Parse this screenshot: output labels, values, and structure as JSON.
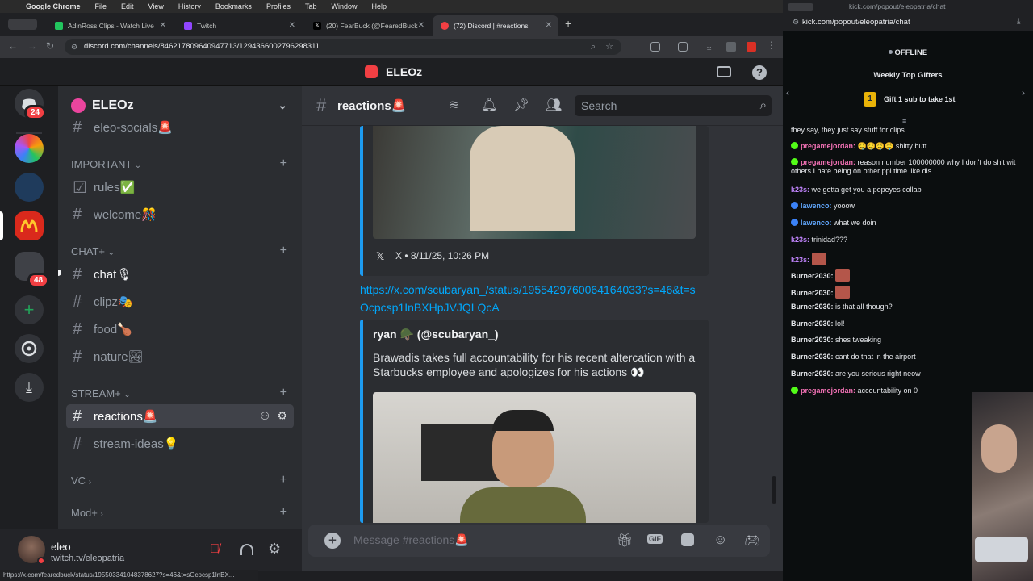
{
  "menubar": {
    "items": [
      "Google Chrome",
      "File",
      "Edit",
      "View",
      "History",
      "Bookmarks",
      "Profiles",
      "Tab",
      "Window",
      "Help"
    ]
  },
  "browser": {
    "tabs": [
      {
        "label": "AdinRoss Clips - Watch Live",
        "active": false
      },
      {
        "label": "Twitch",
        "active": false
      },
      {
        "label": "(20) FearBuck (@FearedBuck",
        "active": false
      },
      {
        "label": "(72) Discord | #reactions",
        "active": true
      }
    ],
    "url": "discord.com/channels/846217809640947713/1294366002796298311",
    "status_url": "https://x.com/fearedbuck/status/195503341048378627?s=46&t=sOcpcsp1lnBX..."
  },
  "discord": {
    "app_title": "ELEOz",
    "rail": {
      "dm_badge": "24",
      "folder_badge": "48"
    },
    "server_name": "ELEOz",
    "categories": {
      "important": "IMPORTANT",
      "chat": "CHAT+",
      "stream": "STREAM+",
      "vc": "VC",
      "mod": "Mod+"
    },
    "channels": {
      "partial": "eleo-socials🚨",
      "rules": "rules✅",
      "welcome": "welcome🎊",
      "chat": "chat🎙",
      "clipz": "clipz🎭",
      "food": "food🍗",
      "nature": "nature🏞",
      "reactions": "reactions🚨",
      "stream_ideas": "stream-ideas💡"
    },
    "channel_title": "reactions🚨",
    "search_placeholder": "Search",
    "messages": {
      "embed1_footer_source": "X",
      "embed1_footer_time": "• 8/11/25, 10:26 PM",
      "link": "https://x.com/scubaryan_/status/1955429760064164033?s=46&t=sOcpcsp1InBXHpJVJQLQcA",
      "embed2_author": "ryan 🪖 (@scubaryan_)",
      "embed2_text": "Brawadis takes full accountability for his recent altercation with a Starbucks employee and apologizes for his actions 👀"
    },
    "composer_placeholder": "Message #reactions🚨",
    "user": {
      "name": "eleo",
      "status": "twitch.tv/eleopatria"
    }
  },
  "kick": {
    "title": "kick.com/popout/eleopatria/chat",
    "url": "kick.com/popout/eleopatria/chat",
    "status": "OFFLINE",
    "gifters_title": "Weekly Top Gifters",
    "gift_rank": "1",
    "gift_text": "Gift 1 sub to take 1st",
    "messages": [
      {
        "user": "",
        "text": "they say, they just say stuff for clips",
        "color": "#e5e7eb",
        "icon": ""
      },
      {
        "user": "pregamejordan",
        "text": "🤤🤤🤤🤤 shitty butt",
        "color": "#f472b6",
        "icon": "#53fc18"
      },
      {
        "user": "pregamejordan",
        "text": "reason number 100000000 why I don't do shit wit others I hate being on other ppl time like dis",
        "color": "#f472b6",
        "icon": "#53fc18"
      },
      {
        "user": "k23s",
        "text": "we gotta get you a popeyes collab",
        "color": "#c084fc",
        "icon": ""
      },
      {
        "user": "lawenco",
        "text": "yooow",
        "color": "#60a5fa",
        "icon": "#3b82f6"
      },
      {
        "user": "lawenco",
        "text": "what we doin",
        "color": "#60a5fa",
        "icon": "#3b82f6"
      },
      {
        "user": "k23s",
        "text": "trinidad???",
        "color": "#c084fc",
        "icon": ""
      },
      {
        "user": "k23s",
        "text": "",
        "color": "#c084fc",
        "icon": ""
      },
      {
        "user": "Burner2030",
        "text": "",
        "color": "#e5e7eb",
        "icon": ""
      },
      {
        "user": "Burner2030",
        "text": "",
        "color": "#e5e7eb",
        "icon": ""
      },
      {
        "user": "Burner2030",
        "text": "is that all though?",
        "color": "#e5e7eb",
        "icon": ""
      },
      {
        "user": "Burner2030",
        "text": "lol!",
        "color": "#e5e7eb",
        "icon": ""
      },
      {
        "user": "Burner2030",
        "text": "shes tweaking",
        "color": "#e5e7eb",
        "icon": ""
      },
      {
        "user": "Burner2030",
        "text": "cant do that in the airport",
        "color": "#e5e7eb",
        "icon": ""
      },
      {
        "user": "Burner2030",
        "text": "are you serious right neow",
        "color": "#e5e7eb",
        "icon": ""
      },
      {
        "user": "pregamejordan",
        "text": "accountability on 0",
        "color": "#f472b6",
        "icon": "#53fc18"
      }
    ]
  }
}
